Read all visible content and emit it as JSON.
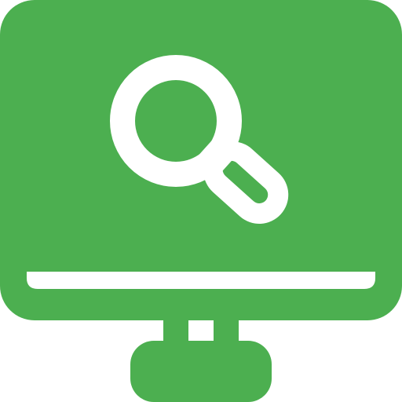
{
  "icon": {
    "name": "monitor-search-icon",
    "parts": [
      "monitor-icon",
      "magnifying-glass-icon",
      "stand-icon"
    ]
  },
  "colors": {
    "primary": "#4caf50",
    "foreground": "#ffffff",
    "background": "#ffffff"
  }
}
